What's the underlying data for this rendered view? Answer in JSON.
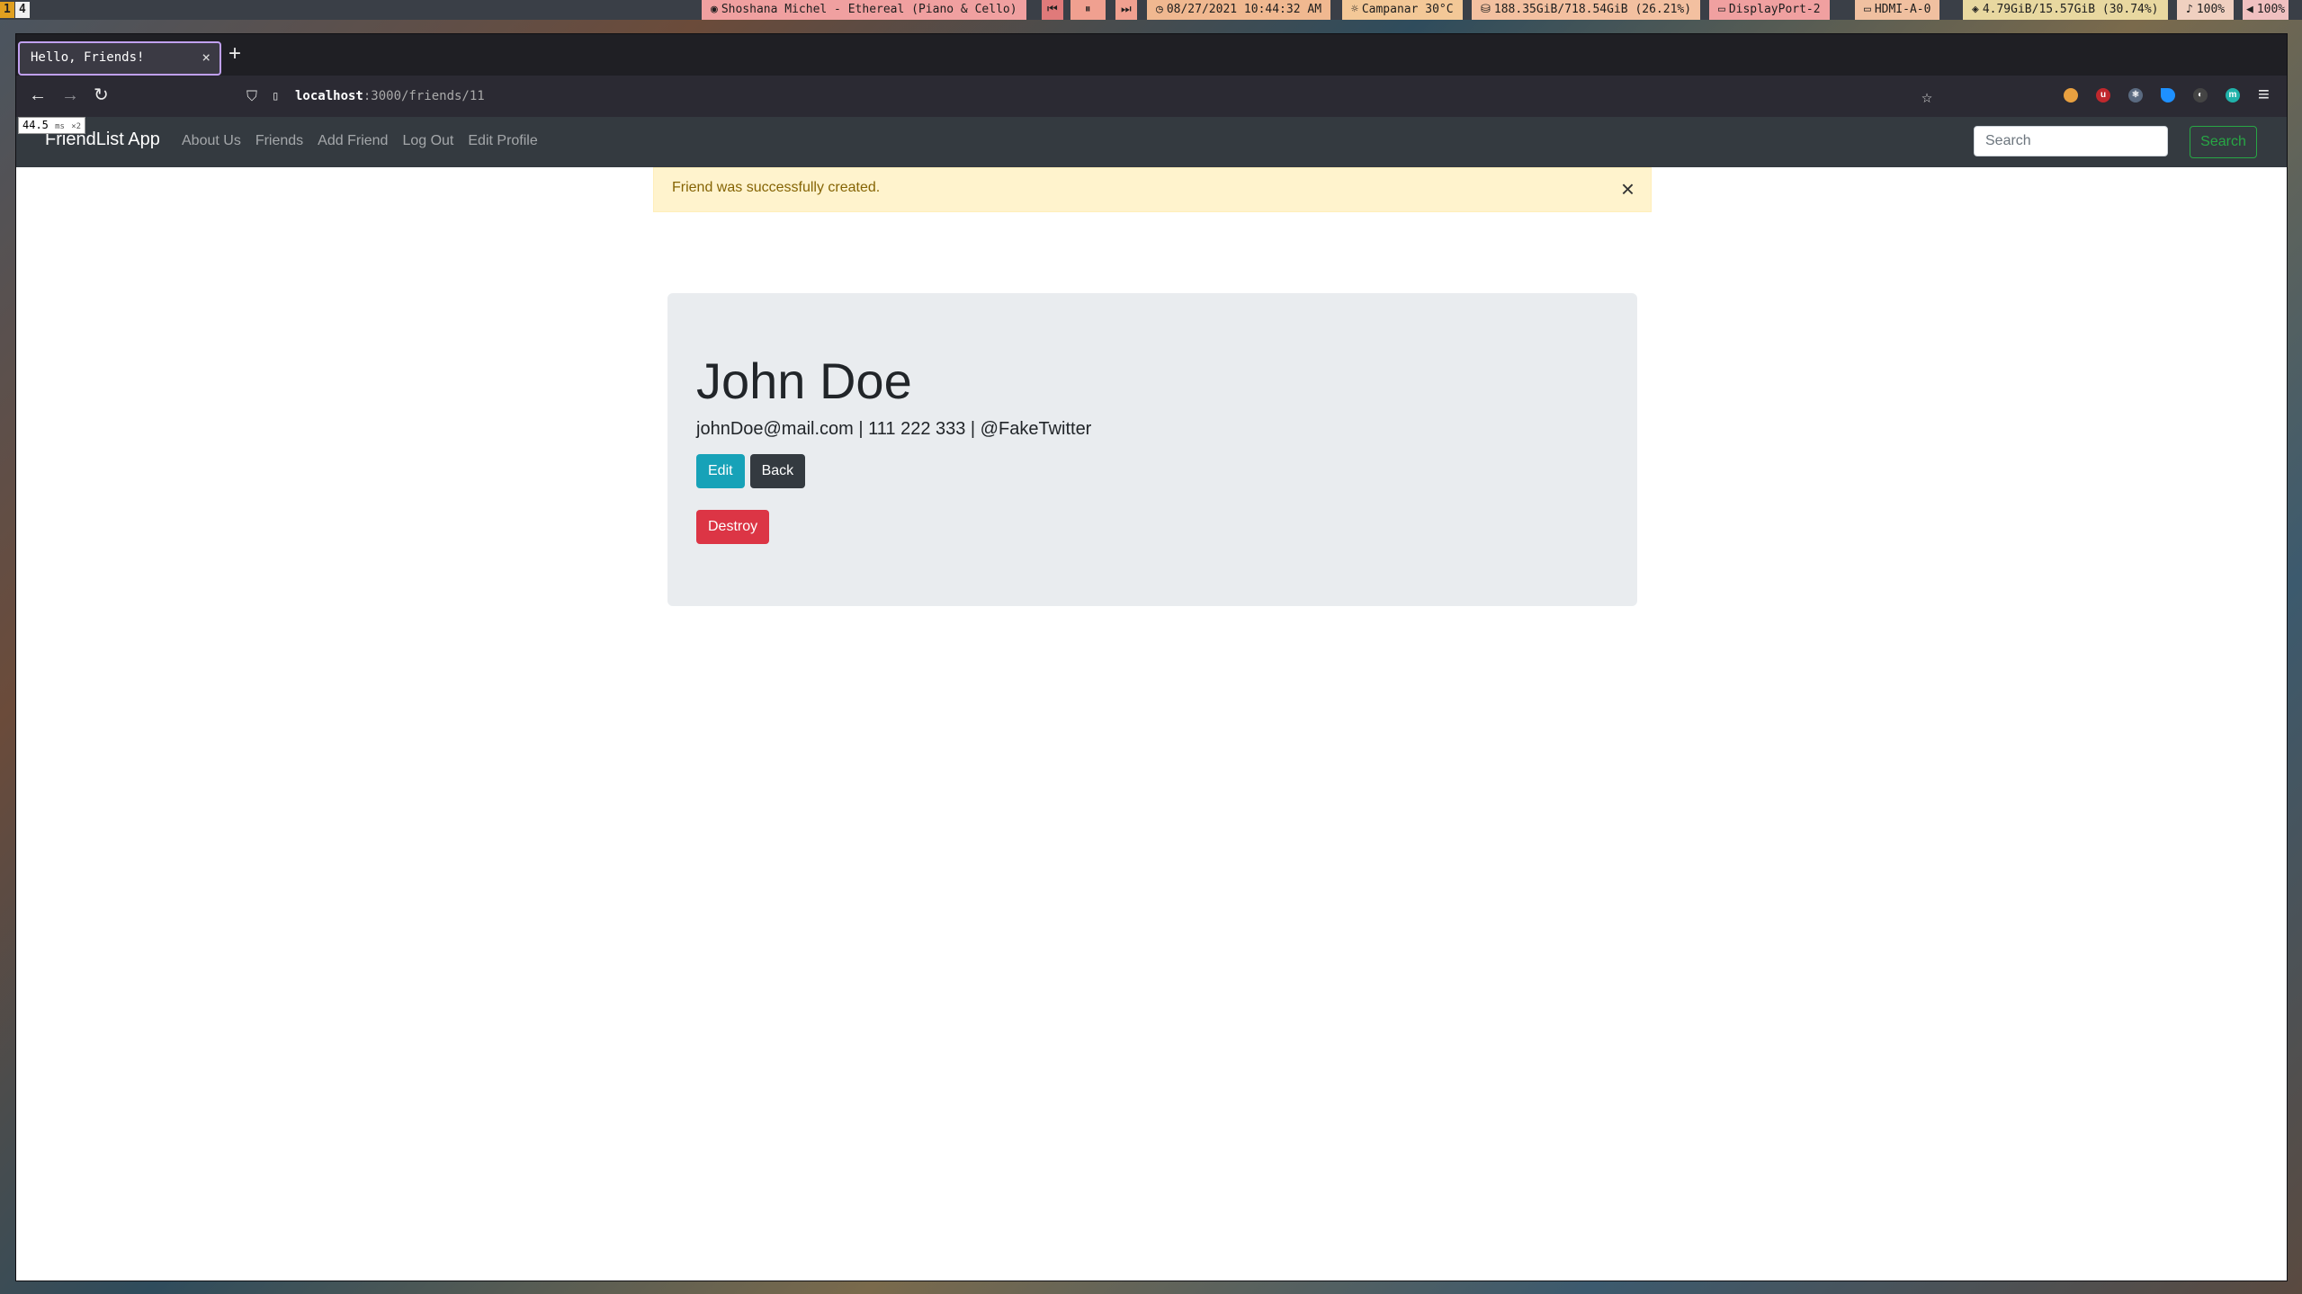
{
  "statusbar": {
    "workspace_active": "1",
    "workspace_other": "4",
    "music": "Shoshana Michel - Ethereal (Piano & Cello)",
    "prev_icon": "prev-track-icon",
    "pause_icon": "pause-icon",
    "next_icon": "next-track-icon",
    "datetime": "08/27/2021 10:44:32 AM",
    "weather": "Campanar 30°C",
    "disk": "188.35GiB/718.54GiB (26.21%)",
    "display1": "DisplayPort-2",
    "display2": "HDMI-A-0",
    "memory": "4.79GiB/15.57GiB (30.74%)",
    "mic": "100%",
    "volume": "100%"
  },
  "browser": {
    "tab_title": "Hello, Friends!",
    "tab_close": "×",
    "new_tab": "+",
    "url_host": "localhost",
    "url_path": ":3000/friends/11",
    "perf_value": "44.5",
    "perf_unit": "ms",
    "perf_extra": "×2"
  },
  "app": {
    "brand": "FriendList App",
    "nav": [
      "About Us",
      "Friends",
      "Add Friend",
      "Log Out",
      "Edit Profile"
    ],
    "search_placeholder": "Search",
    "search_button": "Search"
  },
  "alert": {
    "message": "Friend was successfully created.",
    "close": "×"
  },
  "friend": {
    "name": "John Doe",
    "info": "johnDoe@mail.com | 111 222 333 | @FakeTwitter",
    "edit": "Edit",
    "back": "Back",
    "destroy": "Destroy"
  },
  "colors": {
    "navbar": "#343a40",
    "alert_bg": "#fff3cd",
    "info": "#17a2b8",
    "dark": "#343a40",
    "danger": "#dc3545",
    "success": "#28a745",
    "jumbotron": "#e9ecef"
  }
}
